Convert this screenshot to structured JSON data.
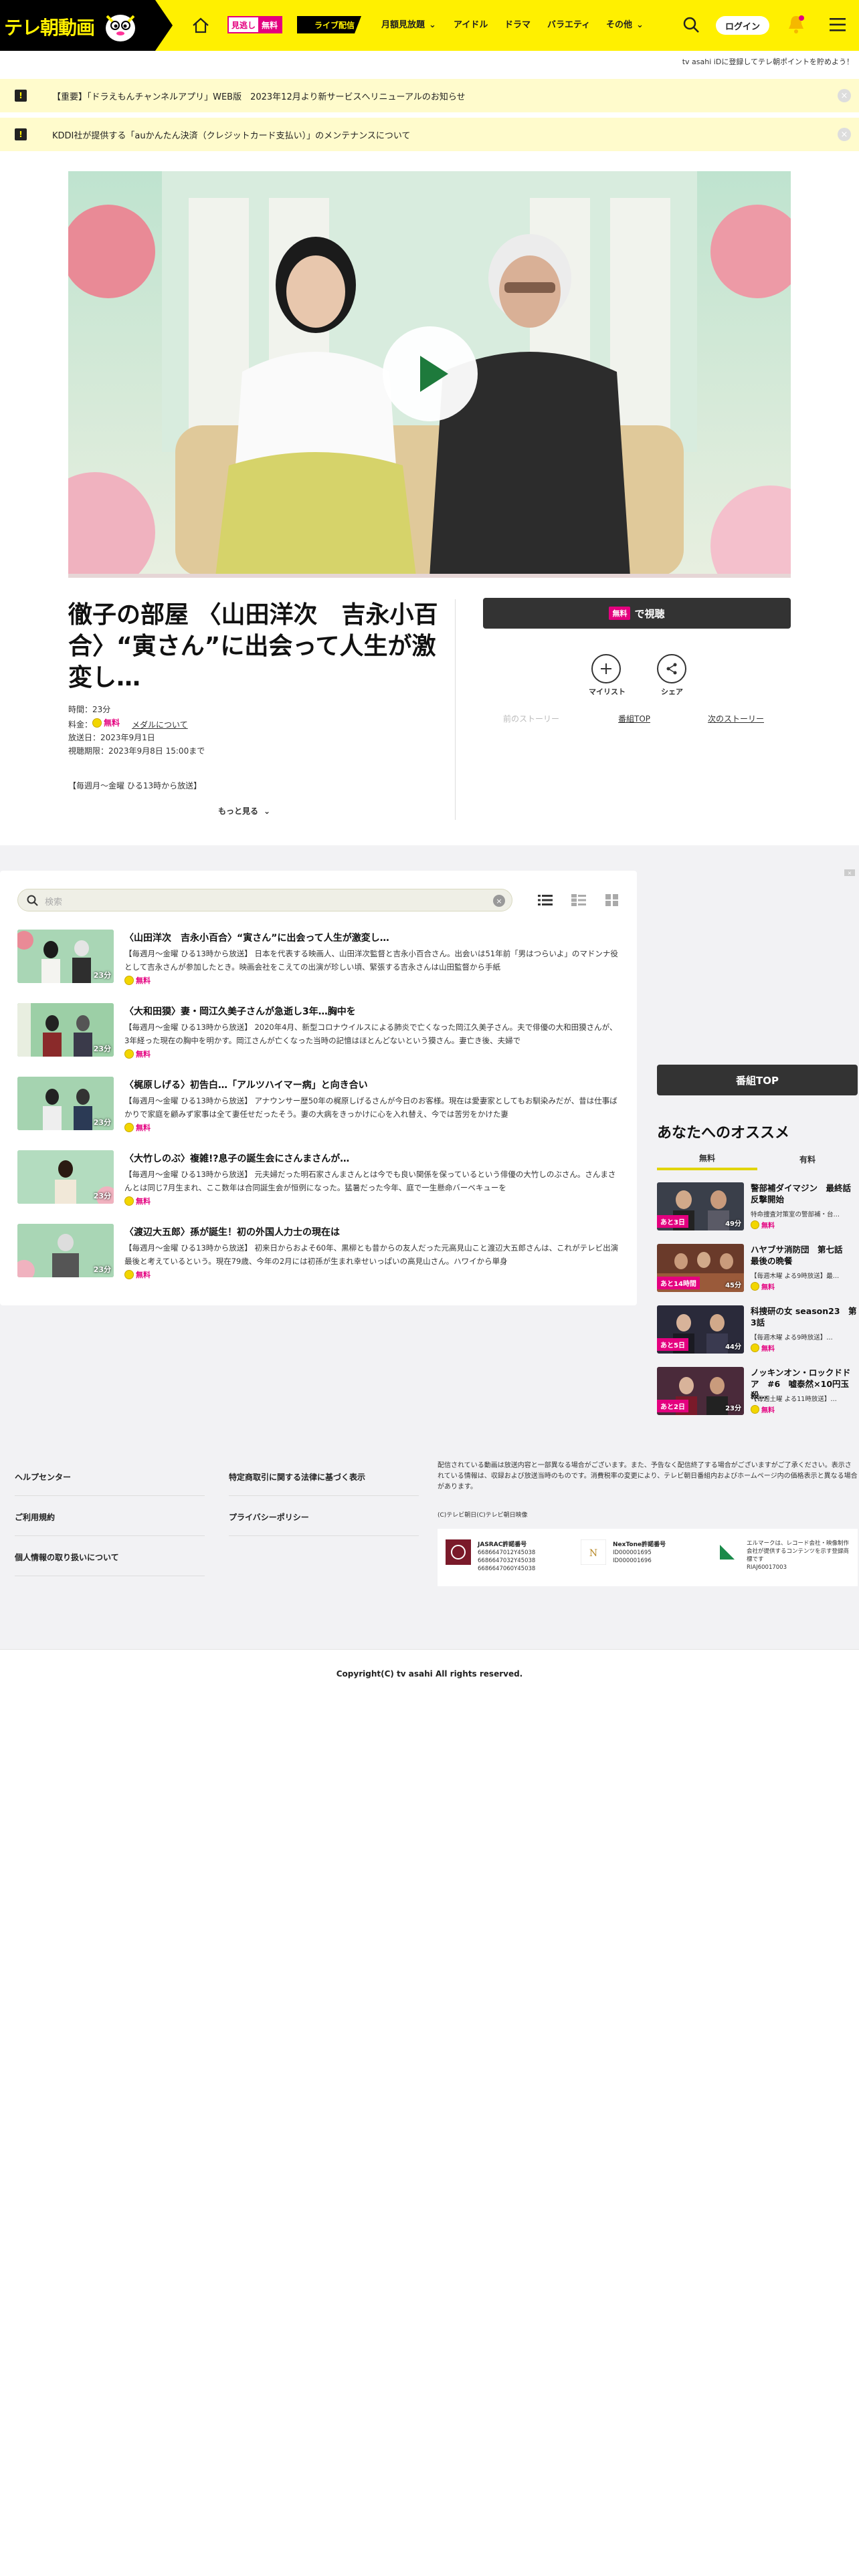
{
  "header": {
    "logo_text": "テレ朝動画",
    "mitoshi": {
      "a": "見逃し",
      "b": "無料"
    },
    "live_label": "ライブ配信",
    "nav": {
      "monthly": "月額見放題",
      "idol": "アイドル",
      "drama": "ドラマ",
      "variety": "バラエティ",
      "other": "その他"
    },
    "login_label": "ログイン",
    "sub_note": "tv asahi iDに登録してテレ朝ポイントを貯めよう！"
  },
  "notices": [
    {
      "icon": "!",
      "text": "【重要】「ドラえもんチャンネルアプリ」WEB版　2023年12月より新サービスへリニューアルのお知らせ"
    },
    {
      "icon": "!",
      "text": "KDDI社が提供する「auかんたん決済（クレジットカード支払い）」のメンテナンスについて"
    }
  ],
  "program": {
    "title": "徹子の部屋 〈山田洋次　吉永小百合〉“寅さん”に出会って人生が激変し…",
    "duration": "時間：23分",
    "fee_label": "料金：",
    "free": "無料",
    "medal_link": "メダルについて",
    "air_date": "放送日：2023年9月1日",
    "deadline": "視聴期限：2023年9月8日 15:00まで",
    "schedule": "【毎週月～金曜 ひる13時から放送】",
    "more": "もっと見る",
    "watch": {
      "tag": "無料",
      "label": "で視聴"
    },
    "mylist": "マイリスト",
    "share": "シェア",
    "prev": "前のストーリー",
    "top": "番組TOP",
    "next": "次のストーリー"
  },
  "search": {
    "placeholder": "検索"
  },
  "episodes": [
    {
      "title": "〈山田洋次　吉永小百合〉“寅さん”に出会って人生が激変し…",
      "desc": "【毎週月～金曜 ひる13時から放送】 日本を代表する映画人、山田洋次監督と吉永小百合さん。出会いは51年前「男はつらいよ」のマドンナ役として吉永さんが参加したとき。映画会社をこえての出演が珍しい頃、緊張する吉永さんは山田監督から手紙",
      "duration": "23分",
      "free": "無料"
    },
    {
      "title": "〈大和田獏〉妻・岡江久美子さんが急逝し3年…胸中を",
      "desc": "【毎週月～金曜 ひる13時から放送】 2020年4月、新型コロナウイルスによる肺炎で亡くなった岡江久美子さん。夫で俳優の大和田獏さんが、3年経った現在の胸中を明かす。岡江さんが亡くなった当時の記憶はほとんどないという獏さん。妻亡き後、夫婦で",
      "duration": "23分",
      "free": "無料"
    },
    {
      "title": "〈梶原しげる〉初告白…「アルツハイマー病」と向き合い",
      "desc": "【毎週月～金曜 ひる13時から放送】 アナウンサー歴50年の梶原しげるさんが今日のお客様。現在は愛妻家としてもお馴染みだが、昔は仕事ばかりで家庭を顧みず家事は全て妻任せだったそう。妻の大病をきっかけに心を入れ替え、今では苦労をかけた妻",
      "duration": "23分",
      "free": "無料"
    },
    {
      "title": "〈大竹しのぶ〉複雑!?息子の誕生会にさんまさんが…",
      "desc": "【毎週月～金曜 ひる13時から放送】 元夫婦だった明石家さんまさんとは今でも良い関係を保っているという俳優の大竹しのぶさん。さんまさんとは同じ7月生まれ、ここ数年は合同誕生会が恒例になった。猛暑だった今年、庭で一生懸命バーベキューを",
      "duration": "23分",
      "free": "無料"
    },
    {
      "title": "〈渡辺大五郎〉孫が誕生！初の外国人力士の現在は",
      "desc": "【毎週月～金曜 ひる13時から放送】 初来日からおよそ60年、黒柳とも昔からの友人だった元高見山こと渡辺大五郎さんは、これがテレビ出演最後と考えているという。現在79歳、今年の2月には初孫が生まれ幸せいっぱいの高見山さん。ハワイから単身",
      "duration": "23分",
      "free": "無料"
    }
  ],
  "sidebar": {
    "top_button": "番組TOP",
    "rec_title": "あなたへのオススメ",
    "tabs": [
      "無料",
      "有料"
    ],
    "items": [
      {
        "title": "警部補ダイマジン　最終話　反撃開始",
        "sub": "特命捜査対策室の警部補・台…",
        "left": "あと3日",
        "duration": "49分",
        "free": "無料"
      },
      {
        "title": "ハヤブサ消防団　第七話　最後の晩餐",
        "sub": "【毎週木曜 よる9時放送】最…",
        "left": "あと14時間",
        "duration": "45分",
        "free": "無料"
      },
      {
        "title": "科捜研の女 season23　第3話",
        "sub": "【毎週木曜 よる9時放送】…",
        "left": "あと5日",
        "duration": "44分",
        "free": "無料"
      },
      {
        "title": "ノッキンオン・ロックドドア　#6　嘘泰然×10円玉殺…",
        "sub": "【毎週土曜 よる11時放送】…",
        "left": "あと2日",
        "duration": "23分",
        "free": "無料"
      }
    ]
  },
  "footer": {
    "col1": [
      "ヘルプセンター",
      "ご利用規約",
      "個人情報の取り扱いについて"
    ],
    "col2": [
      "特定商取引に関する法律に基づく表示",
      "プライバシーポリシー"
    ],
    "note": "配信されている動画は放送内容と一部異なる場合がございます。また、予告なく配信終了する場合がございますがご了承ください。表示されている情報は、収録および放送当時のものです。消費税率の変更により、テレビ朝日番組内およびホームページ内の価格表示と異なる場合があります。",
    "small_copy": "(C)テレビ朝日(C)テレビ朝日映像",
    "licenses": [
      {
        "head": "JASRAC許諾番号",
        "body": "6686647012Y45038\n6686647032Y45038\n6686647060Y45038"
      },
      {
        "head": "NexTone許諾番号",
        "body": "ID000001695\nID000001696"
      },
      {
        "head": "エルマーク",
        "body": "エルマークは、レコード会社・映像制作\n会社が提供するコンテンツを示す登録商\n標です\nRIAJ60017003"
      }
    ],
    "copyright": "Copyright(C) tv asahi All rights reserved."
  },
  "colors": {
    "brand_yellow": "#fff000",
    "accent_pink": "#e4007f",
    "dark_button": "#333333"
  }
}
